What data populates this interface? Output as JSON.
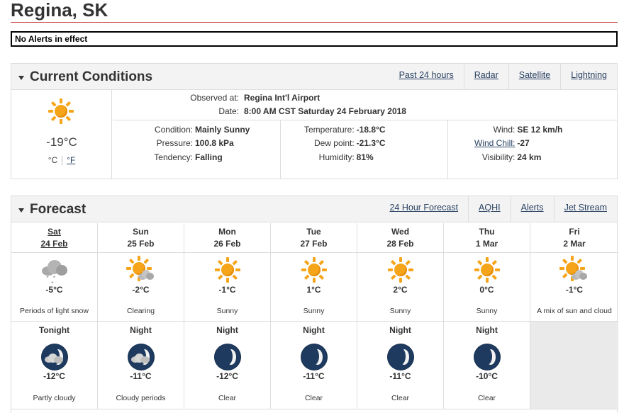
{
  "city": "Regina, SK",
  "alert": "No Alerts in effect",
  "current": {
    "title": "Current Conditions",
    "links": [
      "Past 24 hours",
      "Radar",
      "Satellite",
      "Lightning"
    ],
    "icon": "sun-icon",
    "temp": "-19°C",
    "unit_c": "°C",
    "unit_f": "°F",
    "observed_label": "Observed at:",
    "observed_value": "Regina Int'l Airport",
    "date_label": "Date:",
    "date_value": "8:00 AM CST Saturday 24 February 2018",
    "col1": [
      {
        "label": "Condition:",
        "value": "Mainly Sunny"
      },
      {
        "label": "Pressure:",
        "value": "100.8 kPa"
      },
      {
        "label": "Tendency:",
        "value": "Falling"
      }
    ],
    "col2": [
      {
        "label": "Temperature:",
        "value": "-18.8°C"
      },
      {
        "label": "Dew point:",
        "value": "-21.3°C"
      },
      {
        "label": "Humidity:",
        "value": "81%"
      }
    ],
    "col3": [
      {
        "label": "Wind:",
        "value": "SE 12 km/h"
      },
      {
        "label": "Wind Chill:",
        "value": "-27"
      },
      {
        "label": "Visibility:",
        "value": "24 km"
      }
    ]
  },
  "forecast": {
    "title": "Forecast",
    "links": [
      "24 Hour Forecast",
      "AQHI",
      "Alerts",
      "Jet Stream"
    ],
    "days": [
      {
        "day": "Sat",
        "date": "24 Feb",
        "temp": "-5°C",
        "summary": "Periods of light snow",
        "icon": "snow-cloud-icon"
      },
      {
        "day": "Sun",
        "date": "25 Feb",
        "temp": "-2°C",
        "summary": "Clearing",
        "icon": "sun-cloud-icon"
      },
      {
        "day": "Mon",
        "date": "26 Feb",
        "temp": "-1°C",
        "summary": "Sunny",
        "icon": "sun-icon"
      },
      {
        "day": "Tue",
        "date": "27 Feb",
        "temp": "1°C",
        "summary": "Sunny",
        "icon": "sun-icon"
      },
      {
        "day": "Wed",
        "date": "28 Feb",
        "temp": "2°C",
        "summary": "Sunny",
        "icon": "sun-icon"
      },
      {
        "day": "Thu",
        "date": "1 Mar",
        "temp": "0°C",
        "summary": "Sunny",
        "icon": "sun-icon"
      },
      {
        "day": "Fri",
        "date": "2 Mar",
        "temp": "-1°C",
        "summary": "A mix of sun and cloud",
        "icon": "sun-cloud-icon"
      }
    ],
    "nights": [
      {
        "label": "Tonight",
        "temp": "-12°C",
        "summary": "Partly cloudy",
        "icon": "moon-cloud-icon"
      },
      {
        "label": "Night",
        "temp": "-11°C",
        "summary": "Cloudy periods",
        "icon": "moon-cloud-icon"
      },
      {
        "label": "Night",
        "temp": "-12°C",
        "summary": "Clear",
        "icon": "moon-icon"
      },
      {
        "label": "Night",
        "temp": "-11°C",
        "summary": "Clear",
        "icon": "moon-icon"
      },
      {
        "label": "Night",
        "temp": "-11°C",
        "summary": "Clear",
        "icon": "moon-icon"
      },
      {
        "label": "Night",
        "temp": "-10°C",
        "summary": "Clear",
        "icon": "moon-icon"
      }
    ]
  }
}
